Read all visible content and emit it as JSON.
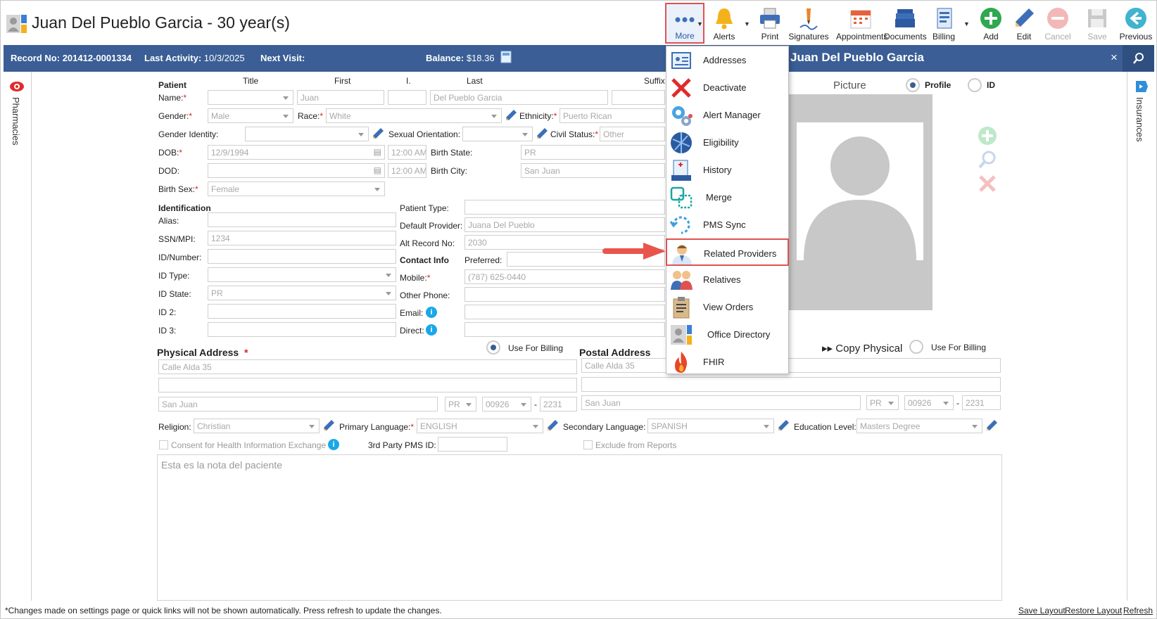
{
  "header": {
    "title": "Juan Del Pueblo Garcia - 30 year(s)"
  },
  "toolbar": {
    "more": "More",
    "alerts": "Alerts",
    "print": "Print",
    "signatures": "Signatures",
    "appointments": "Appointments",
    "documents": "Documents",
    "billing": "Billing",
    "add": "Add",
    "edit": "Edit",
    "cancel": "Cancel",
    "save": "Save",
    "previous": "Previous"
  },
  "record_bar": {
    "record_label": "Record No:",
    "record_value": "201412-0001334",
    "activity_label": "Last Activity:",
    "activity_value": "10/3/2025",
    "next_visit_label": "Next Visit:",
    "balance_label": "Balance:",
    "balance_value": "$18.36",
    "panel_name": "Juan Del Pueblo Garcia",
    "close": "×"
  },
  "side_tabs": {
    "left": "Pharmacies",
    "right": "Insurances"
  },
  "patient": {
    "section": "Patient",
    "col_title": "Title",
    "col_first": "First",
    "col_i": "I.",
    "col_last": "Last",
    "col_suffix": "Suffix",
    "name_label": "Name:",
    "first": "Juan",
    "last": "Del Pueblo Garcia",
    "gender_label": "Gender:",
    "gender": "Male",
    "race_label": "Race:",
    "race": "White",
    "ethnicity_label": "Ethnicity:",
    "ethnicity": "Puerto Rican",
    "gender_identity_label": "Gender Identity:",
    "sexual_orientation_label": "Sexual Orientation:",
    "civil_status_label": "Civil Status:",
    "civil_status": "Other",
    "dob_label": "DOB:",
    "dob": "12/9/1994",
    "dob_time": "12:00 AM",
    "birth_state_label": "Birth State:",
    "birth_state": "PR",
    "dod_label": "DOD:",
    "dod_time": "12:00 AM",
    "birth_city_label": "Birth City:",
    "birth_city": "San Juan",
    "birth_sex_label": "Birth Sex:",
    "birth_sex": "Female"
  },
  "identification": {
    "section": "Identification",
    "alias_label": "Alias:",
    "ssn_label": "SSN/MPI:",
    "ssn": "1234",
    "id_number_label": "ID/Number:",
    "id_type_label": "ID Type:",
    "id_state_label": "ID State:",
    "id_state": "PR",
    "id2_label": "ID 2:",
    "id3_label": "ID 3:",
    "patient_type_label": "Patient Type:",
    "default_provider_label": "Default Provider:",
    "default_provider": "Juana Del Pueblo",
    "alt_record_label": "Alt Record No:",
    "alt_record": "2030"
  },
  "contact": {
    "section": "Contact Info",
    "preferred_label": "Preferred:",
    "mobile_label": "Mobile:",
    "mobile": "(787) 625-0440",
    "other_phone_label": "Other Phone:",
    "email_label": "Email:",
    "direct_label": "Direct:"
  },
  "physical_address": {
    "section": "Physical Address",
    "use_for_billing": "Use For Billing",
    "line1": "Calle Alda 35",
    "city": "San Juan",
    "state": "PR",
    "zip": "00926",
    "zip_ext": "2231"
  },
  "postal_address": {
    "section": "Postal Address",
    "copy_physical": "Copy Physical",
    "use_for_billing": "Use For Billing",
    "line1": "Calle Alda 35",
    "city": "San Juan",
    "state": "PR",
    "zip": "00926",
    "zip_ext": "2231"
  },
  "misc": {
    "religion_label": "Religion:",
    "religion": "Christian",
    "primary_language_label": "Primary Language:",
    "primary_language": "ENGLISH",
    "secondary_language_label": "Secondary Language:",
    "secondary_language": "SPANISH",
    "education_label": "Education Level:",
    "education": "Masters Degree",
    "consent_label": "Consent for Health Information Exchange",
    "pms_id_label": "3rd Party PMS ID:",
    "exclude_label": "Exclude from Reports",
    "note": "Esta es la nota del paciente"
  },
  "picture": {
    "heading": "Picture",
    "profile": "Profile",
    "id": "ID"
  },
  "more_menu": {
    "items": [
      {
        "label": "Addresses"
      },
      {
        "label": "Deactivate"
      },
      {
        "label": "Alert Manager"
      },
      {
        "label": "Eligibility"
      },
      {
        "label": "History"
      },
      {
        "label": "Merge"
      },
      {
        "label": "PMS Sync"
      },
      {
        "label": "Related Providers"
      },
      {
        "label": "Relatives"
      },
      {
        "label": "View Orders"
      },
      {
        "label": "Office Directory"
      },
      {
        "label": "FHIR"
      }
    ],
    "highlighted": "Related Providers"
  },
  "footer": {
    "note": "*Changes made on settings page or quick links will not be shown automatically. Press refresh to update the changes.",
    "save_layout": "Save Layout",
    "restore_layout": "Restore Layout",
    "refresh": "Refresh"
  },
  "colors": {
    "record_bar": "#3a5e95",
    "highlight": "#e05252",
    "required": "#dd2222",
    "info": "#1aa7e8"
  }
}
